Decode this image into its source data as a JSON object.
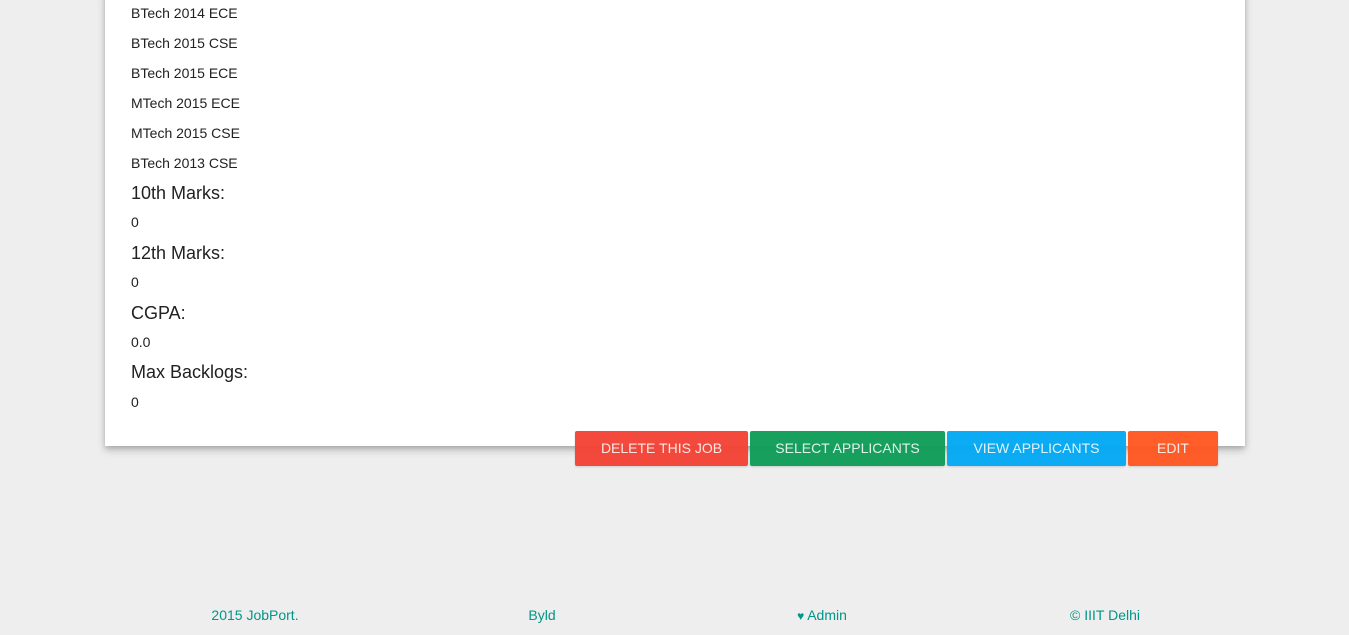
{
  "job_details": {
    "branches": [
      "BTech 2014 ECE",
      "BTech 2015 CSE",
      "BTech 2015 ECE",
      "MTech 2015 ECE",
      "MTech 2015 CSE",
      "BTech 2013 CSE"
    ],
    "criteria": [
      {
        "label": "10th Marks:",
        "value": "0"
      },
      {
        "label": "12th Marks:",
        "value": "0"
      },
      {
        "label": "CGPA:",
        "value": "0.0"
      },
      {
        "label": "Max Backlogs:",
        "value": "0"
      }
    ]
  },
  "actions": {
    "delete_label": "DELETE THIS JOB",
    "select_label": "SELECT APPLICANTS",
    "view_label": "VIEW APPLICANTS",
    "edit_label": "EDIT"
  },
  "colors": {
    "delete": "#f44336",
    "select": "#0f9d58",
    "view": "#03a9f4",
    "edit": "#ff5722",
    "footer_text": "#009688"
  },
  "footer": {
    "copyright_year": "2015 JobPort.",
    "byld": "Byld",
    "heart_icon": "♥",
    "admin": "Admin",
    "institute": "© IIIT Delhi"
  }
}
